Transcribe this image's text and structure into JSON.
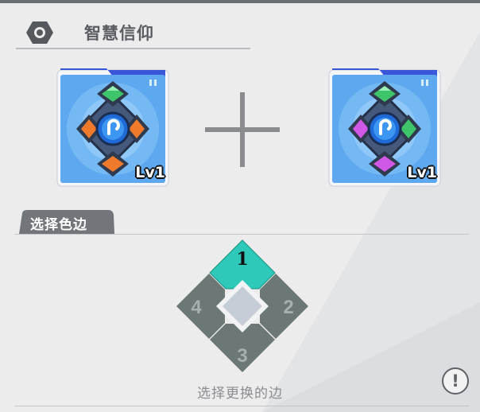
{
  "header": {
    "title": "智慧信仰",
    "icon": "hexagon-ring-icon"
  },
  "cards": [
    {
      "level": "Lv1",
      "gems": {
        "top": "green",
        "right": "orange",
        "bottom": "orange",
        "left": "orange"
      }
    },
    {
      "level": "Lv1",
      "gems": {
        "top": "green",
        "right": "green",
        "bottom": "purple",
        "left": "purple"
      }
    }
  ],
  "section": {
    "title": "选择色边"
  },
  "edge_selector": {
    "edges": [
      "1",
      "2",
      "3",
      "4"
    ],
    "selected": "1"
  },
  "hint": "选择更换的边",
  "info_button": "!",
  "colors": {
    "accent_selected": "#2ec9b8",
    "edge_normal": "#6b7876",
    "gem_green": "#3ec46a",
    "gem_orange": "#f07a2c",
    "gem_purple": "#cf58e6"
  }
}
